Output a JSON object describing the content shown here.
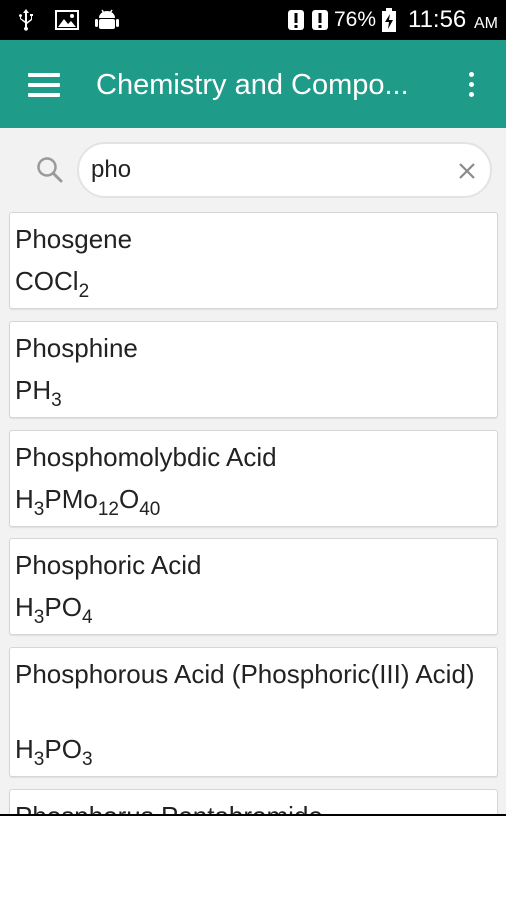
{
  "status_bar": {
    "battery_percent": "76%",
    "time": "11:56",
    "ampm": "AM"
  },
  "app_bar": {
    "title": "Chemistry and Compo..."
  },
  "search": {
    "value": "pho"
  },
  "compounds": [
    {
      "name": "Phosgene",
      "formula": [
        [
          "COCl",
          ""
        ],
        [
          "",
          "2"
        ]
      ]
    },
    {
      "name": "Phosphine",
      "formula": [
        [
          "PH",
          ""
        ],
        [
          "",
          "3"
        ]
      ]
    },
    {
      "name": "Phosphomolybdic Acid",
      "formula": [
        [
          "H",
          ""
        ],
        [
          "",
          "3"
        ],
        [
          "PMo",
          ""
        ],
        [
          "",
          "12"
        ],
        [
          "O",
          ""
        ],
        [
          "",
          "40"
        ]
      ]
    },
    {
      "name": "Phosphoric Acid",
      "formula": [
        [
          "H",
          ""
        ],
        [
          "",
          "3"
        ],
        [
          "PO",
          ""
        ],
        [
          "",
          "4"
        ]
      ]
    },
    {
      "name": "Phosphorous Acid (Phosphoric(III) Acid)",
      "formula": [
        [
          "H",
          ""
        ],
        [
          "",
          "3"
        ],
        [
          "PO",
          ""
        ],
        [
          "",
          "3"
        ]
      ]
    },
    {
      "name": "Phosphorus Pentabromide",
      "formula": []
    }
  ]
}
